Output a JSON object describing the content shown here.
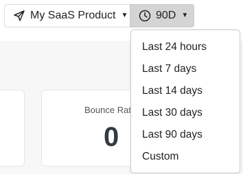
{
  "header": {
    "product_button_label": "My SaaS Product",
    "range_button_label": "90D"
  },
  "icons": {
    "product": "send-icon",
    "range": "clock-icon",
    "caret": "caret-down-icon"
  },
  "metrics": {
    "bounce_rate_label": "Bounce Rate",
    "bounce_rate_value": "0"
  },
  "range_menu": {
    "items": [
      {
        "label": "Last 24 hours"
      },
      {
        "label": "Last 7 days"
      },
      {
        "label": "Last 14 days"
      },
      {
        "label": "Last 30 days"
      },
      {
        "label": "Last 90 days"
      },
      {
        "label": "Custom"
      }
    ]
  },
  "colors": {
    "active_button_bg": "#d4d4d4",
    "page_bg": "#f7f7f7",
    "metric_value": "#333a40"
  }
}
